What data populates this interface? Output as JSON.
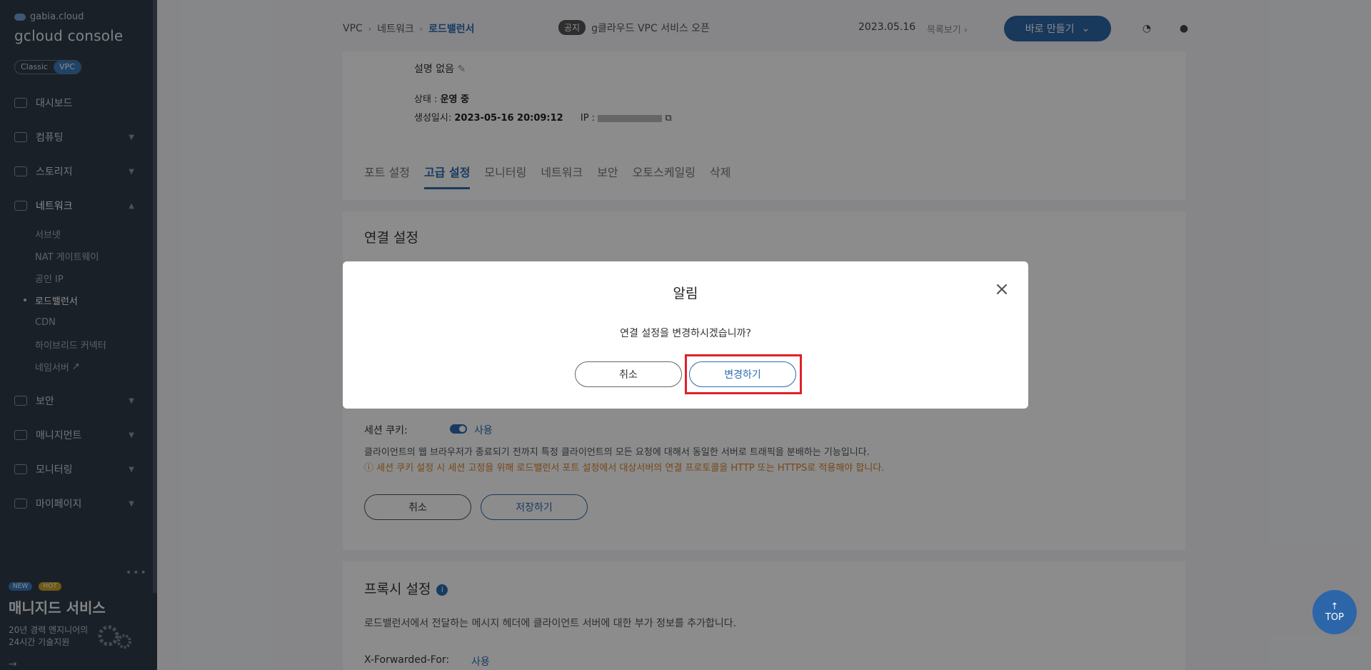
{
  "sidebar": {
    "brand_small": "gabia.cloud",
    "brand_big": "gcloud console",
    "toggle": [
      "Classic",
      "VPC"
    ],
    "items": [
      {
        "label": "대시보드",
        "icon": "dashboard-icon"
      },
      {
        "label": "컴퓨팅",
        "icon": "chip-icon"
      },
      {
        "label": "스토리지",
        "icon": "storage-icon"
      },
      {
        "label": "네트워크",
        "icon": "network-icon"
      }
    ],
    "network_sub": [
      "서브넷",
      "NAT 게이트웨이",
      "공인 IP",
      "로드밸런서",
      "CDN",
      "하이브리드 커넥터",
      "네임서버"
    ],
    "items2": [
      {
        "label": "보안",
        "icon": "shield-icon"
      },
      {
        "label": "매니지먼트",
        "icon": "management-icon"
      },
      {
        "label": "모니터링",
        "icon": "monitor-icon"
      },
      {
        "label": "마이페이지",
        "icon": "user-icon"
      }
    ],
    "promo": {
      "badge_new": "NEW",
      "badge_hot": "HOT",
      "title": "매니지드 서비스",
      "line1": "20년 경력 엔지니어의",
      "line2": "24시간 기술지원"
    }
  },
  "header": {
    "breadcrumb": [
      "VPC",
      "네트워크",
      "로드밸런서"
    ],
    "notice_tag": "공지",
    "notice_text": "g클라우드 VPC 서비스 오픈",
    "notice_date": "2023.05.16",
    "more_label": "목록보기",
    "make_button": "바로 만들기"
  },
  "detail": {
    "desc_label": "설명 없음",
    "status_label": "상태 :",
    "status_value": "운영 중",
    "created_label": "생성일시:",
    "created_value": "2023-05-16 20:09:12",
    "ip_label": "IP :"
  },
  "tabs": [
    "포트 설정",
    "고급 설정",
    "모니터링",
    "네트워크",
    "보안",
    "오토스케일링",
    "삭제"
  ],
  "connection": {
    "title": "연결 설정",
    "session_label": "세션 쿠키:",
    "session_value": "사용",
    "session_desc": "클라이언트의 웹 브라우저가 종료되기 전까지 특정 클라이언트의 모든 요청에 대해서 동일한 서버로 트래픽을 분배하는 기능입니다.",
    "session_warn": "ⓘ 세션 쿠키 설정 시 세션 고정을 위해 로드밸런서 포트 설정에서 대상서버의 연결 프로토콜을 HTTP 또는 HTTPS로 적용해야 합니다.",
    "cancel": "취소",
    "save": "저장하기"
  },
  "proxy": {
    "title": "프록시 설정",
    "desc": "로드밸런서에서 전달하는 메시지 헤더에 클라이언트 서버에 대한 부가 정보를 추가합니다.",
    "xff_label": "X-Forwarded-For:",
    "xff_value": "사용"
  },
  "top_button": "TOP",
  "modal": {
    "title": "알림",
    "message": "연결 설정을 변경하시겠습니까?",
    "cancel": "취소",
    "confirm": "변경하기"
  }
}
